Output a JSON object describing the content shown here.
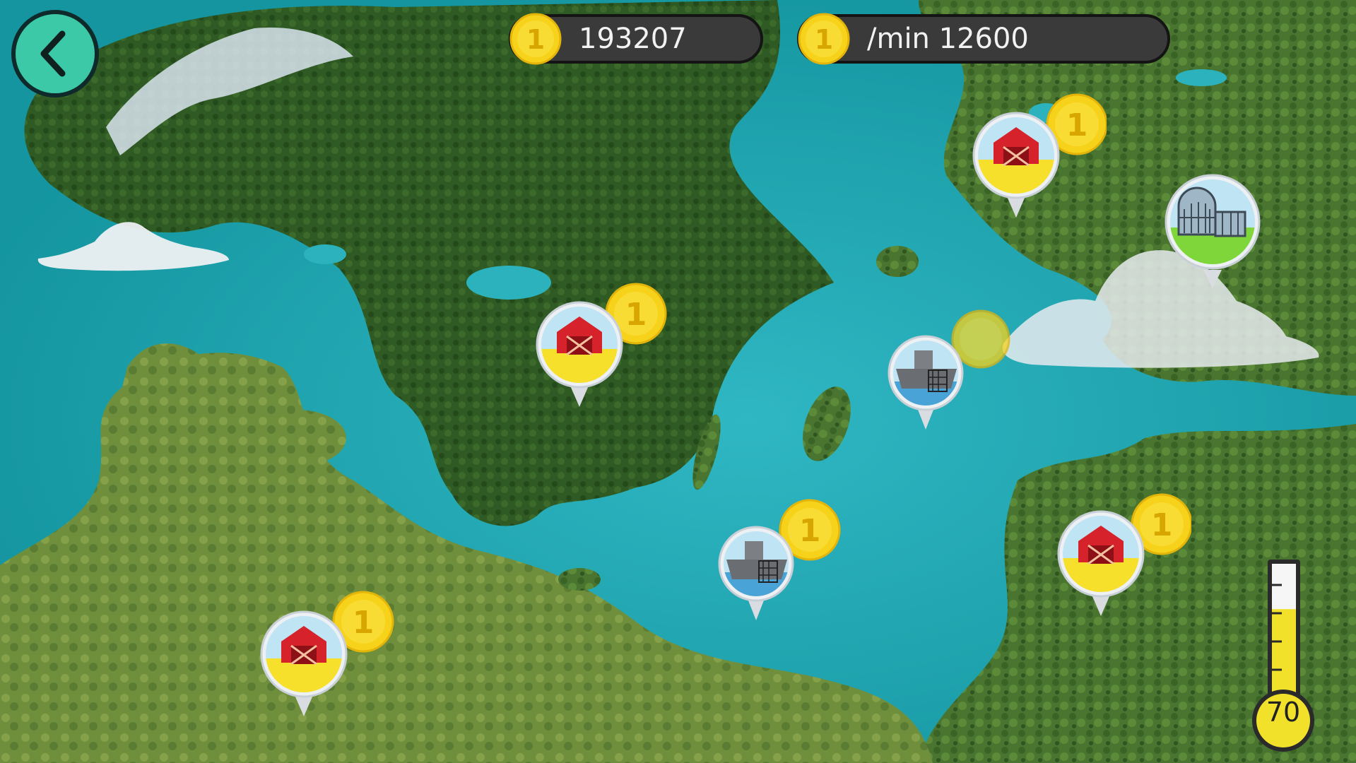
{
  "hud": {
    "back_icon": "chevron-left-icon",
    "total_coins": "193207",
    "rate_label": "/min 12600",
    "coin_icon": "coin-icon",
    "coin_glyph": "1"
  },
  "map": {
    "sites": [
      {
        "type": "farm",
        "icon": "barn-icon",
        "coin_ready": true
      },
      {
        "type": "farm",
        "icon": "barn-icon",
        "coin_ready": true
      },
      {
        "type": "farm",
        "icon": "barn-icon",
        "coin_ready": true
      },
      {
        "type": "farm",
        "icon": "barn-icon",
        "coin_ready": true
      },
      {
        "type": "fishing",
        "icon": "fishing-boat-icon",
        "coin_ready": true
      },
      {
        "type": "fishing",
        "icon": "fishing-boat-icon",
        "coin_ready": true
      },
      {
        "type": "greenhouse",
        "icon": "greenhouse-icon",
        "coin_ready": false
      }
    ]
  },
  "thermometer": {
    "value": "70",
    "level_fraction": 0.7,
    "fill_color": "#f2e12a"
  },
  "colors": {
    "sea": "#1aa6b0",
    "land": "#4f7a2e",
    "coin": "#f7d21a",
    "back_button": "#3cc9a8"
  }
}
